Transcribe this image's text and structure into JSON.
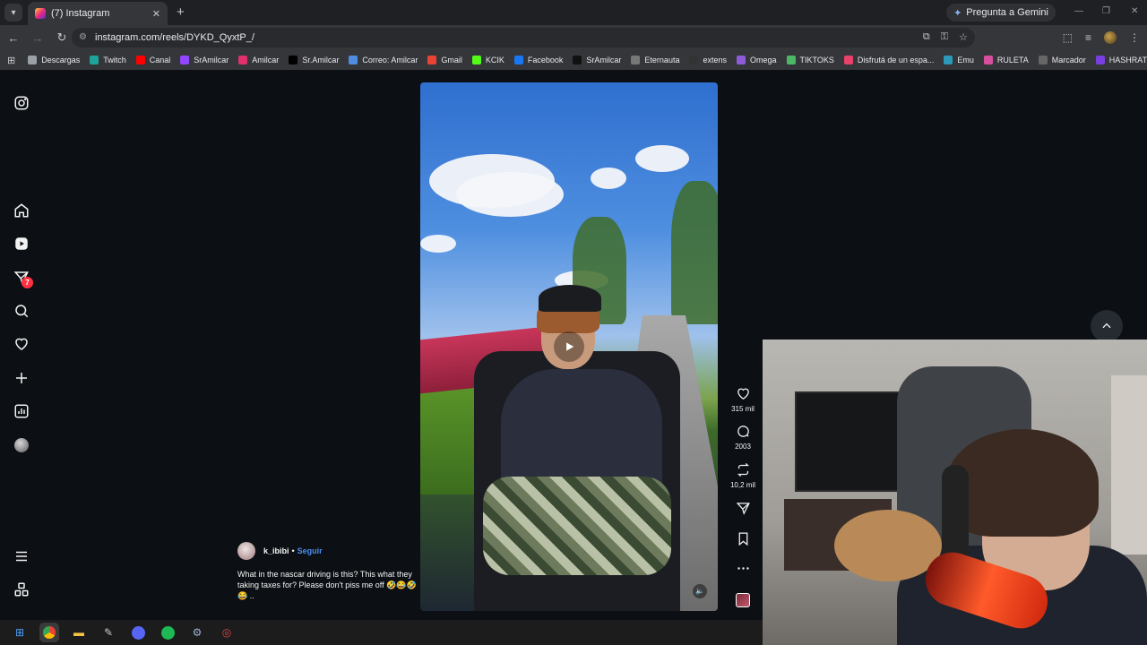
{
  "browser": {
    "tab": {
      "title": "(7) Instagram",
      "close": "✕"
    },
    "new_tab": "+",
    "gemini_label": "Pregunta a Gemini",
    "url": "instagram.com/reels/DYKD_QyxtP_/",
    "window_controls": {
      "minimize": "—",
      "restore": "❐",
      "close": "✕"
    }
  },
  "bookmarks": [
    {
      "label": "Descargas",
      "color": "#9aa0a6"
    },
    {
      "label": "Twitch",
      "color": "#1fa39b"
    },
    {
      "label": "Canal",
      "color": "#ff0000"
    },
    {
      "label": "SrAmilcar",
      "color": "#9146ff"
    },
    {
      "label": "Amilcar",
      "color": "#e1306c"
    },
    {
      "label": "Sr.Amilcar",
      "color": "#000000"
    },
    {
      "label": "Correo: Amilcar",
      "color": "#4f8de0"
    },
    {
      "label": "Gmail",
      "color": "#ea4335"
    },
    {
      "label": "KCIK",
      "color": "#53fc18"
    },
    {
      "label": "Facebook",
      "color": "#1877f2"
    },
    {
      "label": "SrAmilcar",
      "color": "#111111"
    },
    {
      "label": "Eternauta",
      "color": "#777777"
    },
    {
      "label": "extens",
      "color": "#333333"
    },
    {
      "label": "Omega",
      "color": "#8e5bd8"
    },
    {
      "label": "TIKTOKS",
      "color": "#4ab866"
    },
    {
      "label": "Disfrutá de un espa...",
      "color": "#e8426a"
    },
    {
      "label": "Emu",
      "color": "#2b9ab8"
    },
    {
      "label": "RULETA",
      "color": "#d94fa0"
    },
    {
      "label": "Marcador",
      "color": "#666666"
    },
    {
      "label": "HASHRATE AGENCY",
      "color": "#7a3fe0"
    }
  ],
  "sidebar": {
    "notification_count": "7",
    "items": [
      "instagram-logo",
      "home",
      "reels",
      "messages",
      "search",
      "notifications",
      "create",
      "dashboard",
      "profile",
      "more",
      "threads"
    ]
  },
  "reel": {
    "likes": "315 mil",
    "comments": "2003",
    "reposts": "10,2 mil",
    "username": "k_ibibi",
    "separator": "•",
    "follow_label": "Seguir",
    "caption": "What in the nascar driving is this? This what they taking taxes for? Please don't piss me off 🤣😂🤣😂 .."
  },
  "colors": {
    "background": "#0c0f14",
    "follow_link": "#4a8ef0",
    "badge": "#ff3040"
  }
}
